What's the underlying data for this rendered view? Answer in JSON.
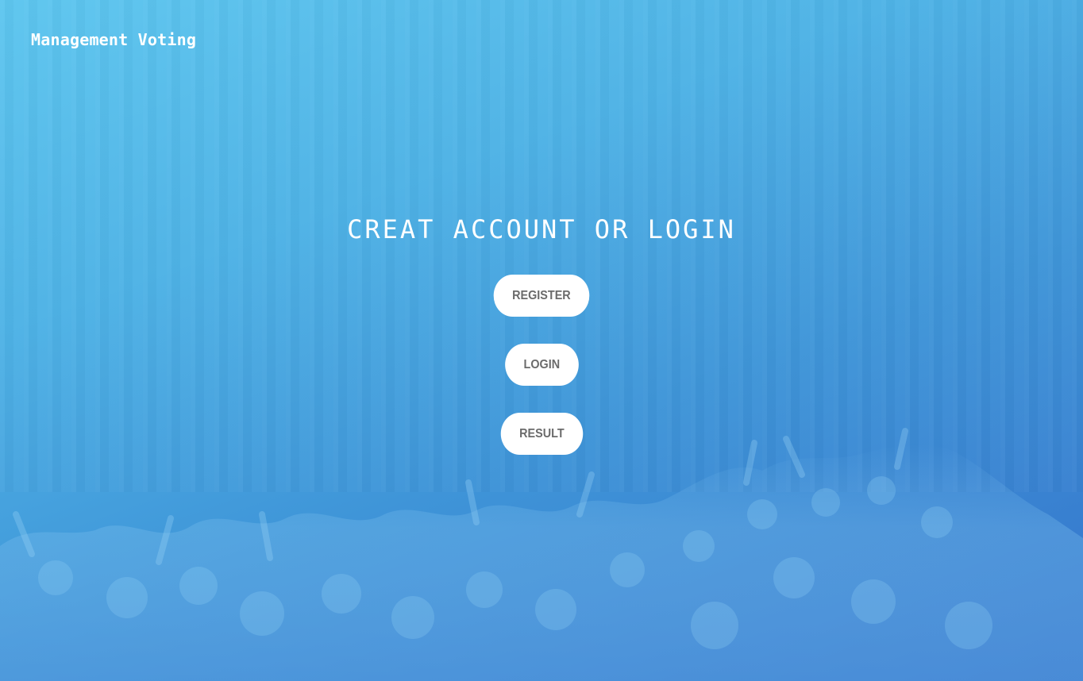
{
  "header": {
    "brand": "Management Voting"
  },
  "main": {
    "headline": "CREAT ACCOUNT OR LOGIN",
    "buttons": {
      "register": "REGISTER",
      "login": "LOGIN",
      "result": "RESULT"
    }
  },
  "colors": {
    "gradient_start": "#5ec6ef",
    "gradient_end": "#3472cb",
    "button_bg": "#ffffff",
    "button_text": "#6b6b6b"
  }
}
